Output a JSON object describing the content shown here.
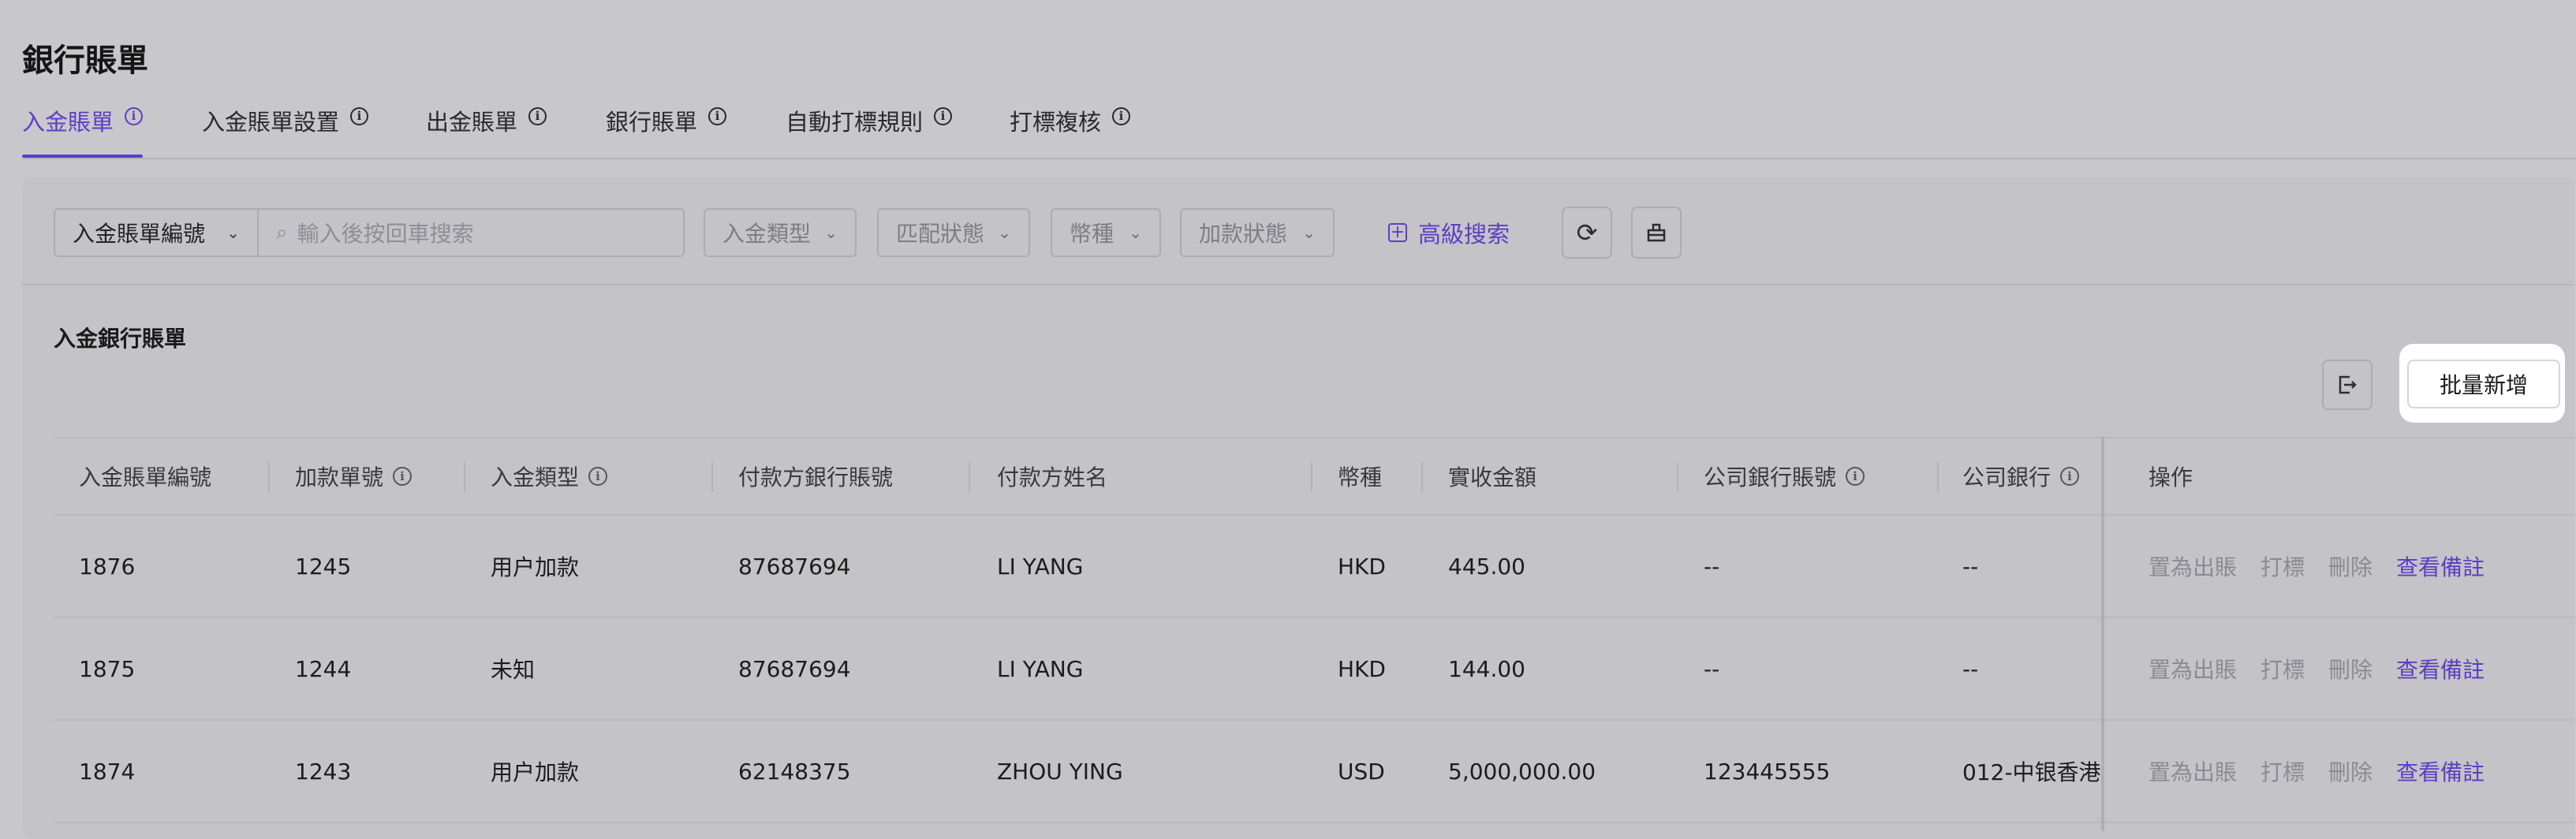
{
  "page": {
    "title": "銀行賬單"
  },
  "tabs": [
    {
      "label": "入金賬單",
      "active": true
    },
    {
      "label": "入金賬單設置",
      "active": false
    },
    {
      "label": "出金賬單",
      "active": false
    },
    {
      "label": "銀行賬單",
      "active": false
    },
    {
      "label": "自動打標規則",
      "active": false
    },
    {
      "label": "打標複核",
      "active": false
    }
  ],
  "filters": {
    "search_field": "入金賬單編號",
    "search_placeholder": "輸入後按回車搜索",
    "deposit_type": "入金類型",
    "match_status": "匹配狀態",
    "currency": "幣種",
    "credit_status": "加款狀態",
    "advanced_search": "高級搜索"
  },
  "section": {
    "title": "入金銀行賬單",
    "batch_add": "批量新增"
  },
  "table": {
    "headers": [
      "入金賬單編號",
      "加款單號",
      "入金類型",
      "付款方銀行賬號",
      "付款方姓名",
      "幣種",
      "實收金額",
      "公司銀行賬號",
      "公司銀行",
      "操作"
    ],
    "actions": [
      "置為出賬",
      "打標",
      "刪除",
      "查看備註"
    ],
    "rows": [
      {
        "id": "1876",
        "credit_no": "1245",
        "type": "用户加款",
        "payer_account": "87687694",
        "payer_name": "LI YANG",
        "currency": "HKD",
        "amount": "445.00",
        "company_account": "--",
        "company_bank": "--"
      },
      {
        "id": "1875",
        "credit_no": "1244",
        "type": "未知",
        "payer_account": "87687694",
        "payer_name": "LI YANG",
        "currency": "HKD",
        "amount": "144.00",
        "company_account": "--",
        "company_bank": "--"
      },
      {
        "id": "1874",
        "credit_no": "1243",
        "type": "用户加款",
        "payer_account": "62148375",
        "payer_name": "ZHOU YING",
        "currency": "USD",
        "amount": "5,000,000.00",
        "company_account": "123445555",
        "company_bank": "012-中银香港"
      }
    ]
  },
  "colors": {
    "accent": "#5b3fc4",
    "overlay_bg": "#c8c7cb"
  }
}
